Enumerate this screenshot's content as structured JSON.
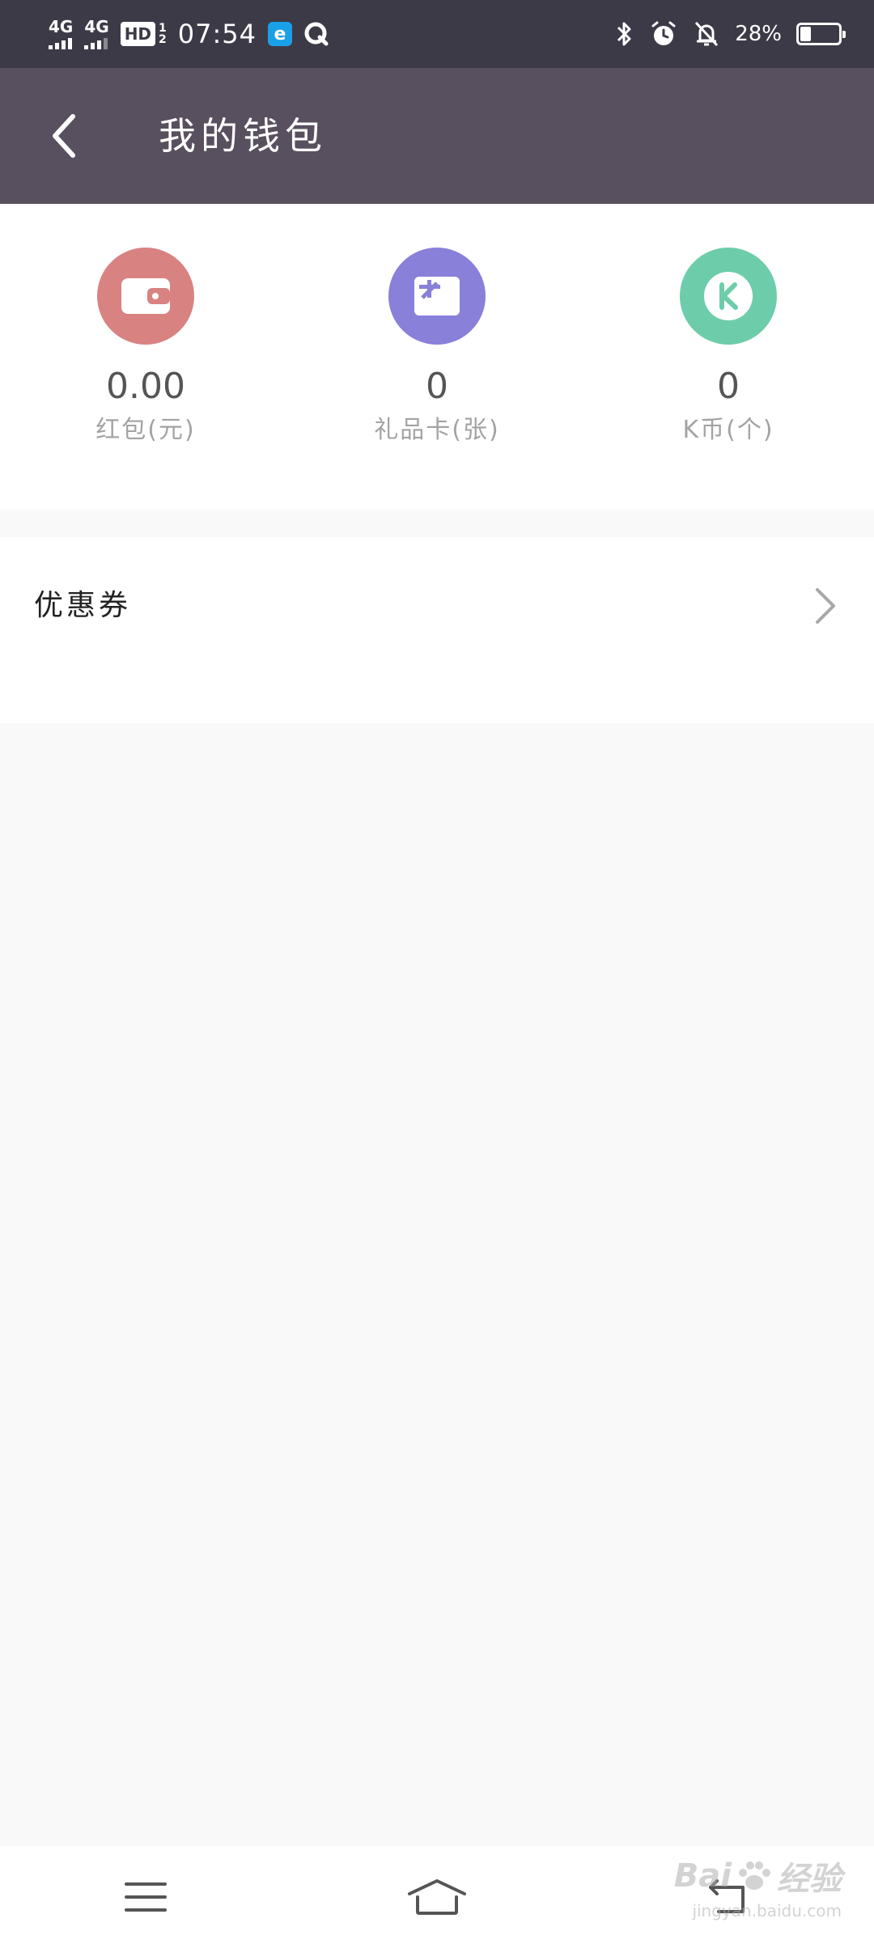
{
  "status_bar": {
    "network_1": "4G",
    "network_2": "4G",
    "hd_label": "HD",
    "hd_sub_top": "1",
    "hd_sub_bottom": "2",
    "time": "07:54",
    "battery_text": "28%",
    "battery_level": 0.28
  },
  "header": {
    "title": "我的钱包"
  },
  "wallet": {
    "items": [
      {
        "value": "0.00",
        "label": "红包(元)",
        "color": "#d98282",
        "icon": "wallet-icon"
      },
      {
        "value": "0",
        "label": "礼品卡(张)",
        "color": "#8880d9",
        "icon": "gift-card-icon"
      },
      {
        "value": "0",
        "label": "K币(个)",
        "color": "#6dcdaa",
        "icon": "k-coin-icon"
      }
    ]
  },
  "coupon": {
    "label": "优惠券"
  },
  "watermark": {
    "brand_latin": "Bai",
    "brand_cn": "经验",
    "url": "jingyan.baidu.com"
  }
}
